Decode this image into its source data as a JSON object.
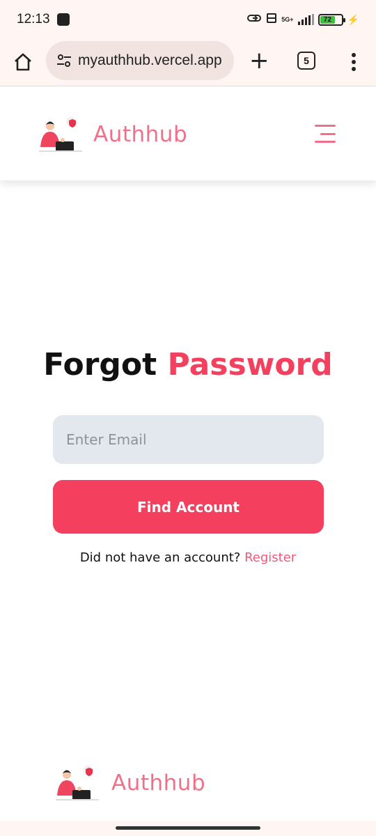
{
  "status_bar": {
    "time": "12:13",
    "network_label": "5G+",
    "battery_level": "72"
  },
  "browser": {
    "url": "myauthhub.vercel.app",
    "tab_count": "5"
  },
  "header": {
    "brand": "Authhub"
  },
  "main": {
    "title_part1": "Forgot",
    "title_part2": "Password",
    "email_placeholder": "Enter Email",
    "find_button_label": "Find Account",
    "register_prompt": "Did not have an account?",
    "register_link": "Register"
  },
  "footer": {
    "brand": "Authhub"
  },
  "colors": {
    "accent": "#f43f5e",
    "brand_pink": "#f0708a",
    "input_bg": "#e3e8ef",
    "browser_chrome": "#fff5f2"
  }
}
